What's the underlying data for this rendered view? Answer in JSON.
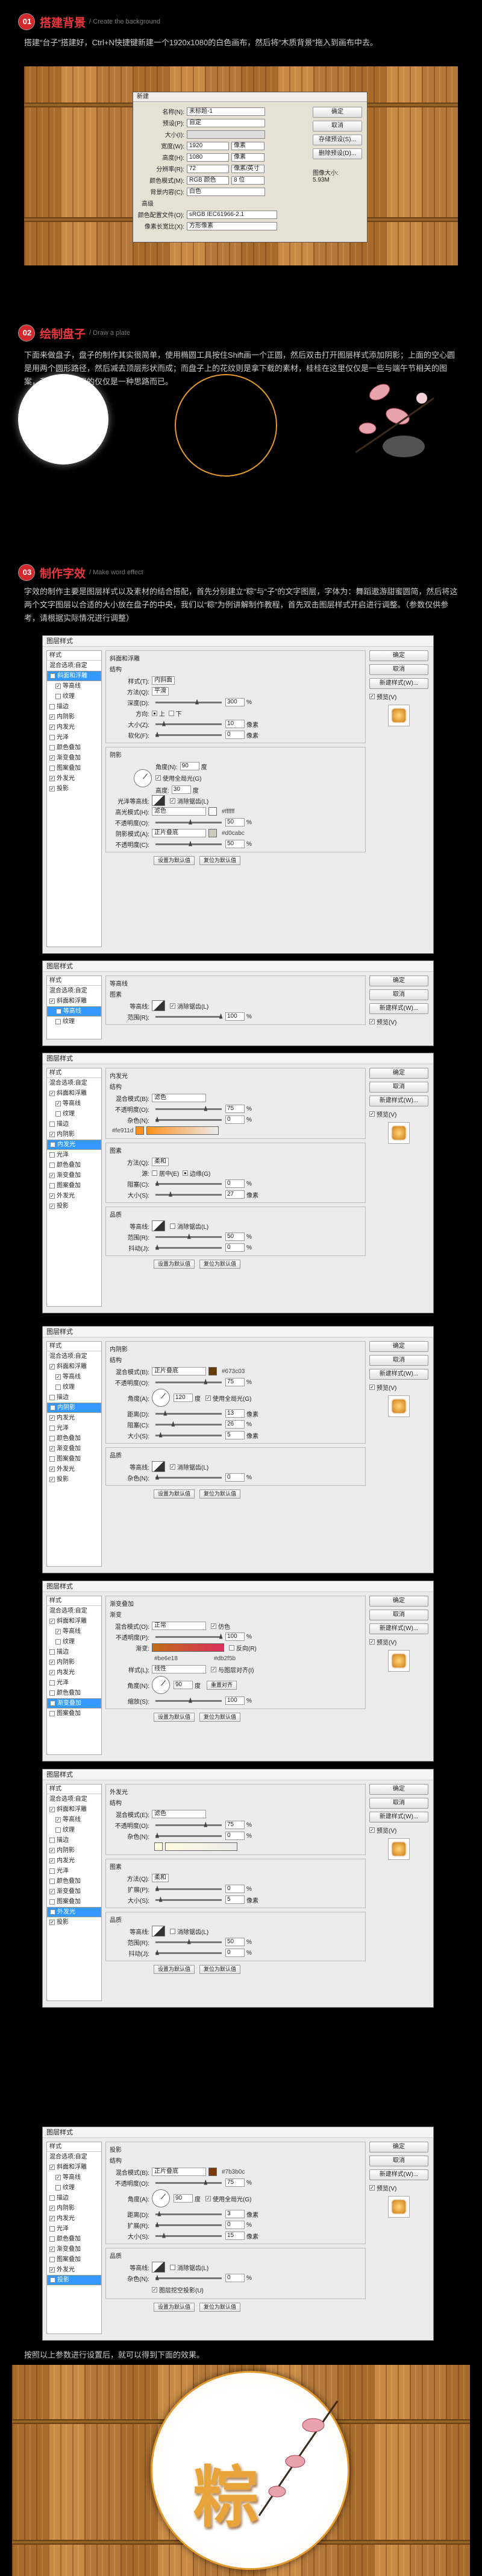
{
  "step1": {
    "num": "01",
    "title": "搭建背景",
    "sub": "/ Create the background",
    "text": "搭建“台子”搭建好，Ctrl+N快捷键新建一个1920x1080的白色画布，然后将“木质背景”拖入到画布中去。"
  },
  "newdoc": {
    "title": "新建",
    "name_label": "名称(N):",
    "name_value": "未标题-1",
    "preset_label": "预设(P):",
    "preset_value": "自定",
    "size_label": "大小(I):",
    "width_label": "宽度(W):",
    "width_value": "1920",
    "width_unit": "像素",
    "height_label": "高度(H):",
    "height_value": "1080",
    "height_unit": "像素",
    "res_label": "分辨率(R):",
    "res_value": "72",
    "res_unit": "像素/英寸",
    "mode_label": "颜色模式(M):",
    "mode_value": "RGB 颜色",
    "mode_bits": "8 位",
    "bg_label": "背景内容(C):",
    "bg_value": "白色",
    "adv_label": "高级",
    "profile_label": "颜色配置文件(O):",
    "profile_value": "sRGB IEC61966-2.1",
    "aspect_label": "像素长宽比(X):",
    "aspect_value": "方形像素",
    "ok": "确定",
    "cancel": "取消",
    "save_preset": "存储预设(S)...",
    "delete_preset": "删除预设(D)...",
    "image_size_label": "图像大小:",
    "image_size_value": "5.93M"
  },
  "step2": {
    "num": "02",
    "title": "绘制盘子",
    "sub": "/ Draw a plate",
    "text": "下面来做盘子，盘子的制作其实很简单，使用椭圆工具按住Shift画一个正圆，然后双击打开图层样式添加阴影；上面的空心圆是用两个圆形路径，然后减去顶层形状而成；而盘子上的花纹则是拿下载的素材，桂桂在这里仅仅是一些与端午节相关的图案，我在这里使用的仅仅是一种思路而已。"
  },
  "step3": {
    "num": "03",
    "title": "制作字效",
    "sub": "/ Make word effect",
    "text": "字效的制作主要是图层样式以及素材的结合搭配，首先分别建立“粽”与“子”的文字图层，字体为：舞蹈遨游甜蜜圆简，然后将这两个文字图层以合适的大小放在盘子的中央，我们以“粽”为例讲解制作教程，首先双击图层样式开启进行调整。（参数仅供参考，请根据实际情况进行调整）"
  },
  "dlg": {
    "title": "图层样式",
    "styles": "样式",
    "blend_opts": "混合选项:自定",
    "ok": "确定",
    "cancel": "取消",
    "new_style": "新建样式(W)...",
    "preview": "预览(V)",
    "set_default": "设置为默认值",
    "reset_default": "复位为默认值",
    "list": [
      "斜面和浮雕",
      "等高线",
      "纹理",
      "描边",
      "内阴影",
      "内发光",
      "光泽",
      "颜色叠加",
      "渐变叠加",
      "图案叠加",
      "外发光",
      "投影"
    ]
  },
  "d1": {
    "section": "斜面和浮雕",
    "struct": "结构",
    "style_l": "样式(T):",
    "style_v": "内斜面",
    "tech_l": "方法(Q):",
    "tech_v": "平滑",
    "depth_l": "深度(D):",
    "depth_v": "300",
    "dir_l": "方向:",
    "dir_up": "上",
    "dir_down": "下",
    "size_l": "大小(Z):",
    "size_v": "10",
    "soften_l": "软化(F):",
    "soften_v": "0",
    "shading": "阴影",
    "angle_l": "角度(N):",
    "angle_v": "90",
    "global": "使用全局光(G)",
    "alt_l": "高度:",
    "alt_v": "30",
    "gloss_l": "光泽等高线:",
    "antialias": "消除锯齿(L)",
    "hl_l": "高光模式(H):",
    "hl_v": "滤色",
    "hl_hex": "#ffffff",
    "op1_l": "不透明度(O):",
    "op1_v": "50",
    "sh_l": "阴影模式(A):",
    "sh_v": "正片叠底",
    "sh_hex": "#d0cabc",
    "op2_l": "不透明度(C):",
    "op2_v": "50"
  },
  "d2": {
    "section": "等高线",
    "elements": "图素",
    "contour_l": "等高线:",
    "antialias": "消除锯齿(L)",
    "range_l": "范围(R):",
    "range_v": "100"
  },
  "d3": {
    "section": "内发光",
    "struct": "结构",
    "blend_l": "混合模式(B):",
    "blend_v": "滤色",
    "op_l": "不透明度(O):",
    "op_v": "75",
    "noise_l": "杂色(N):",
    "noise_v": "0",
    "hex": "#fe911d",
    "elements": "图素",
    "tech_l": "方法(Q):",
    "tech_v": "柔和",
    "src_l": "源:",
    "src_center": "居中(E)",
    "src_edge": "边缘(G)",
    "choke_l": "阻塞(C):",
    "choke_v": "0",
    "size_l": "大小(S):",
    "size_v": "27",
    "quality": "品质",
    "contour_l": "等高线:",
    "antialias": "消除锯齿(L)",
    "range_l": "范围(R):",
    "range_v": "50",
    "jitter_l": "抖动(J):",
    "jitter_v": "0"
  },
  "d4": {
    "section": "内阴影",
    "struct": "结构",
    "blend_l": "混合模式(B):",
    "blend_v": "正片叠底",
    "hex": "#673c03",
    "op_l": "不透明度(O):",
    "op_v": "75",
    "angle_l": "角度(A):",
    "angle_v": "120",
    "global": "使用全局光(G)",
    "dist_l": "距离(D):",
    "dist_v": "13",
    "choke_l": "阻塞(C):",
    "choke_v": "26",
    "size_l": "大小(S):",
    "size_v": "5",
    "quality": "品质",
    "contour_l": "等高线:",
    "antialias": "消除锯齿(L)",
    "noise_l": "杂色(N):",
    "noise_v": "0"
  },
  "d5": {
    "section": "渐变叠加",
    "grad": "渐变",
    "blend_l": "混合模式(O):",
    "blend_v": "正常",
    "dither": "仿色",
    "op_l": "不透明度(P):",
    "op_v": "100",
    "grad_l": "渐变:",
    "reverse": "反向(R)",
    "hex_a": "#be6e18",
    "hex_b": "#db2f5b",
    "style_l": "样式(L):",
    "style_v": "线性",
    "align": "与图层对齐(I)",
    "angle_l": "角度(N):",
    "angle_v": "90",
    "reset_align": "重置对齐",
    "scale_l": "缩放(S):",
    "scale_v": "100"
  },
  "d6": {
    "section": "外发光",
    "struct": "结构",
    "blend_l": "混合模式(E):",
    "blend_v": "滤色",
    "op_l": "不透明度(O):",
    "op_v": "75",
    "noise_l": "杂色(N):",
    "noise_v": "0",
    "elements": "图素",
    "tech_l": "方法(Q):",
    "tech_v": "柔和",
    "spread_l": "扩展(P):",
    "spread_v": "0",
    "size_l": "大小(S):",
    "size_v": "5",
    "quality": "品质",
    "contour_l": "等高线:",
    "antialias": "消除锯齿(L)",
    "range_l": "范围(R):",
    "range_v": "50",
    "jitter_l": "抖动(J):",
    "jitter_v": "0"
  },
  "d7": {
    "section": "投影",
    "struct": "结构",
    "blend_l": "混合模式(B):",
    "blend_v": "正片叠底",
    "hex": "#7b3b0c",
    "op_l": "不透明度(O):",
    "op_v": "75",
    "angle_l": "角度(A):",
    "angle_v": "90",
    "global": "使用全局光(G)",
    "dist_l": "距离(D):",
    "dist_v": "3",
    "spread_l": "扩展(R):",
    "spread_v": "0",
    "size_l": "大小(S):",
    "size_v": "15",
    "quality": "品质",
    "contour_l": "等高线:",
    "antialias": "消除锯齿(L)",
    "noise_l": "杂色(N):",
    "noise_v": "0",
    "knockout": "图层挖空投影(U)"
  },
  "final": {
    "text": "按照以上参数进行设置后，就可以得到下面的效果。",
    "char": "粽"
  },
  "colors": {
    "accent": "#d3282c",
    "title_red": "#e8383d",
    "selection": "#3399ff",
    "gold": "#e8a33a"
  }
}
